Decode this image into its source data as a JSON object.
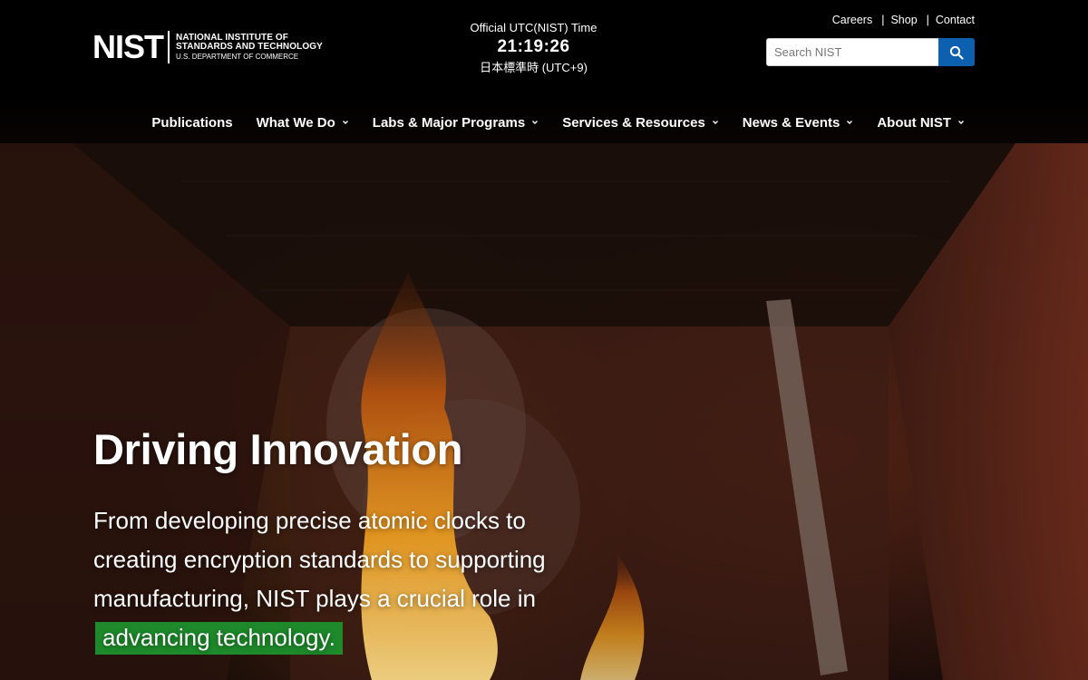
{
  "logo": {
    "mark": "NIST",
    "line1": "NATIONAL INSTITUTE OF",
    "line2": "STANDARDS AND TECHNOLOGY",
    "line3": "U.S. DEPARTMENT OF COMMERCE"
  },
  "clock": {
    "label": "Official UTC(NIST) Time",
    "time": "21:19:26",
    "zone": "日本標準時 (UTC+9)"
  },
  "utility_links": [
    "Careers",
    "Shop",
    "Contact"
  ],
  "utility_separator": "|",
  "search": {
    "placeholder": "Search NIST",
    "button_icon": "search-icon"
  },
  "nav": {
    "items": [
      {
        "label": "Publications",
        "has_dropdown": false
      },
      {
        "label": "What We Do",
        "has_dropdown": true
      },
      {
        "label": "Labs & Major Programs",
        "has_dropdown": true
      },
      {
        "label": "Services & Resources",
        "has_dropdown": true
      },
      {
        "label": "News & Events",
        "has_dropdown": true
      },
      {
        "label": "About NIST",
        "has_dropdown": true
      }
    ]
  },
  "hero": {
    "title": "Driving Innovation",
    "body_prefix": "From developing precise atomic clocks to creating encryption standards to supporting manufacturing, NIST plays a crucial role in",
    "body_highlight": "advancing technology.",
    "highlight_color": "#1e8a2b"
  },
  "colors": {
    "header_bg": "#000000",
    "search_button": "#0d5fb0"
  }
}
